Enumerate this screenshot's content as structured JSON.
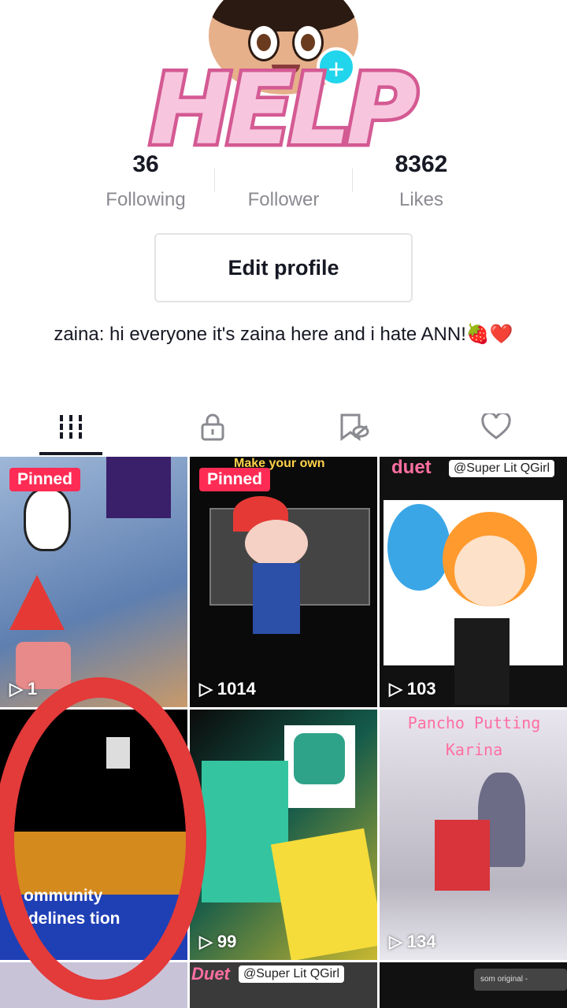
{
  "header": {
    "help_overlay": "HELP",
    "plus_symbol": "+"
  },
  "stats": [
    {
      "value": "36",
      "label": "Following"
    },
    {
      "value": "",
      "label": "Follower"
    },
    {
      "value": "8362",
      "label": "Likes"
    }
  ],
  "edit_profile_label": "Edit profile",
  "bio": "zaina: hi everyone it's zaina here and i hate ANN!🍓❤️",
  "tabs": [
    "videos-grid-icon",
    "lock-icon",
    "bookmark-eye-icon",
    "heart-icon"
  ],
  "videos": [
    {
      "badge": "Pinned",
      "views": "1",
      "caption": ""
    },
    {
      "badge": "Pinned",
      "views": "1014",
      "caption": "Make your own"
    },
    {
      "badge": "",
      "views": "103",
      "caption": "duet",
      "tag": "@Super Lit QGirl"
    },
    {
      "badge": "",
      "views": "",
      "caption": "ommunity idelines tion"
    },
    {
      "badge": "",
      "views": "99",
      "caption": ""
    },
    {
      "badge": "",
      "views": "134",
      "caption": "Pancho Putting Karina"
    },
    {
      "badge": "",
      "views": "",
      "caption": ""
    },
    {
      "badge": "",
      "views": "",
      "caption": "Duet",
      "tag": "@Super Lit QGirl"
    },
    {
      "badge": "",
      "views": "",
      "caption": "som original -"
    }
  ],
  "colors": {
    "accent_red": "#fe2c55",
    "accent_cyan": "#20d5ec",
    "help_pink": "#f7c6de",
    "circle_red": "#e33a3a"
  }
}
